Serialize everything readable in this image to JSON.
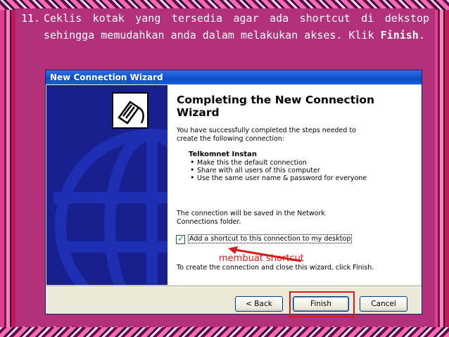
{
  "instruction": {
    "number": "11.",
    "text_before": "Ceklis kotak yang tersedia agar ada shortcut di dekstop sehingga memudahkan anda dalam melakukan akses. Klik ",
    "text_bold": "Finish",
    "text_after": "."
  },
  "wizard": {
    "title": "New Connection Wizard",
    "heading": "Completing the New Connection Wizard",
    "intro": "You have successfully completed the steps needed to create the following connection:",
    "connection_name": "Telkomnet Instan",
    "bullets": [
      "Make this the default connection",
      "Share with all users of this computer",
      "Use the same user name & password for everyone"
    ],
    "saved_text": "The connection will be saved in the Network Connections folder.",
    "shortcut_checkbox_label": "Add a shortcut to this connection to my desktop",
    "shortcut_checked": true,
    "finish_text": "To create the connection and close this wizard, click Finish.",
    "buttons": {
      "back": "< Back",
      "finish": "Finish",
      "cancel": "Cancel"
    }
  },
  "annotation": "membuat shortcut",
  "colors": {
    "accent_red": "#d81b1b",
    "titlebar": "#0a4dc8",
    "sidebar": "#17208e"
  }
}
